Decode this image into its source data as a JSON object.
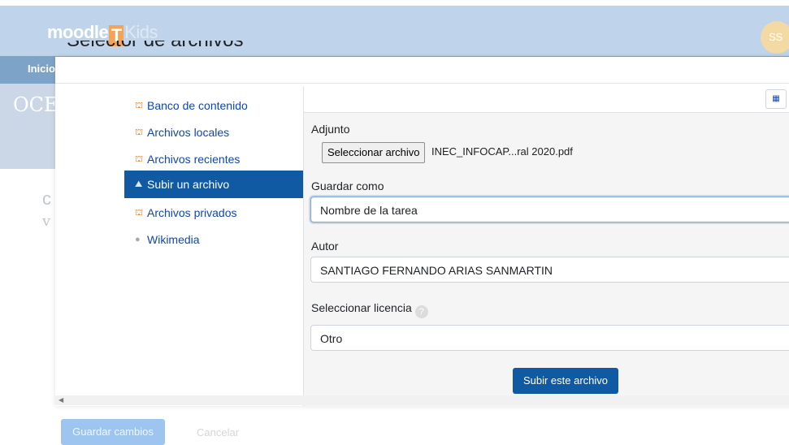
{
  "background": {
    "logo_text": "moodle",
    "logo_letter": "T",
    "logo_kids": "Kids",
    "avatar_text": "SS",
    "nav_item": "Inicio",
    "hero_text": "OCE",
    "left_text_1": "c",
    "left_text_2": "v",
    "save_button": "Guardar cambios",
    "cancel_button": "Cancelar"
  },
  "dialog": {
    "title": "Selector de archivos",
    "repositories": [
      {
        "label": "Banco de contenido",
        "icon": "folder-icon"
      },
      {
        "label": "Archivos locales",
        "icon": "folder-icon"
      },
      {
        "label": "Archivos recientes",
        "icon": "folder-icon"
      },
      {
        "label": "Subir un archivo",
        "icon": "upload-icon",
        "active": true
      },
      {
        "label": "Archivos privados",
        "icon": "folder-icon"
      },
      {
        "label": "Wikimedia",
        "icon": "wikimedia-icon"
      }
    ],
    "view_icon": "grid-view-icon",
    "form": {
      "attachment_label": "Adjunto",
      "file_button": "Seleccionar archivo",
      "file_name": "INEC_INFOCAP...ral 2020.pdf",
      "save_as_label": "Guardar como",
      "save_as_value": "Nombre de la tarea",
      "author_label": "Autor",
      "author_value": "SANTIAGO FERNANDO ARIAS SANMARTIN",
      "license_label": "Seleccionar licencia",
      "license_value": "Otro",
      "submit_button": "Subir este archivo"
    }
  },
  "colors": {
    "primary": "#0f5aa3",
    "link": "#0f47ad",
    "header_bg": "#bfd4ea"
  }
}
